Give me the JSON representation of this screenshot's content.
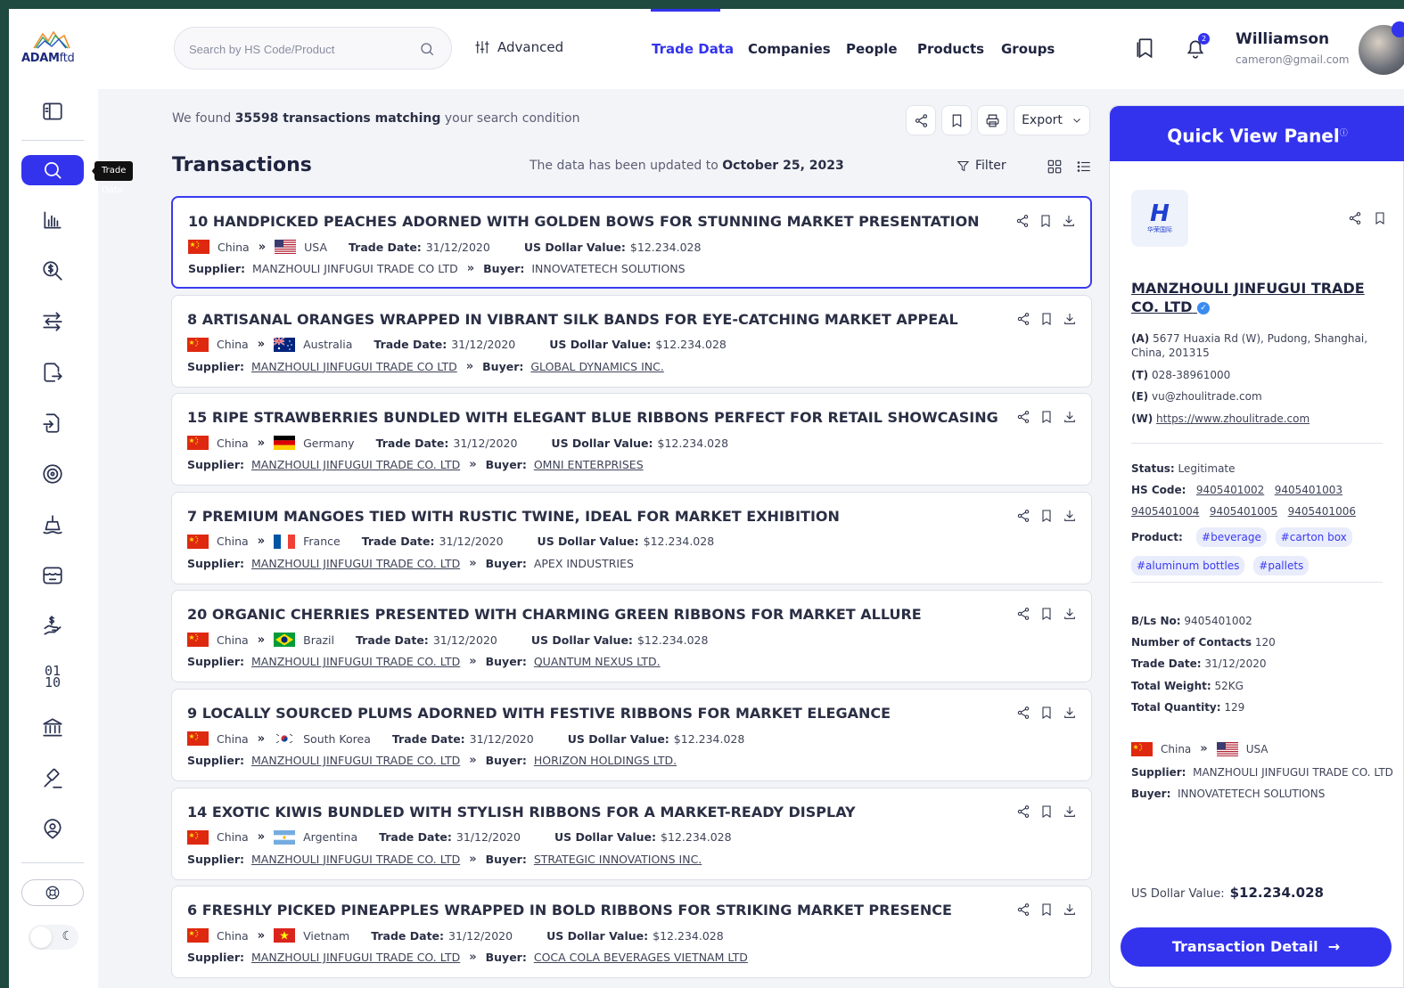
{
  "logo": {
    "brand": "ADAM",
    "suffix": "ftd"
  },
  "sidebar": {
    "tooltip": "Trade Data"
  },
  "search": {
    "placeholder": "Search by HS Code/Product"
  },
  "header": {
    "advanced_label": "Advanced",
    "nav": [
      {
        "label": "Trade Data",
        "active": true
      },
      {
        "label": "Companies",
        "active": false
      },
      {
        "label": "People",
        "active": false
      },
      {
        "label": "Products",
        "active": false
      },
      {
        "label": "Groups",
        "active": false
      }
    ],
    "notification_count": "2",
    "user": {
      "name": "Williamson",
      "email": "cameron@gmail.com"
    }
  },
  "results": {
    "found_prefix": "We found",
    "found_count_text": "35598 transactions matching",
    "found_suffix": "your search condition",
    "export_label": "Export",
    "title": "Transactions",
    "updated_prefix": "The data has been updated to",
    "updated_date": "October 25, 2023",
    "filter_label": "Filter"
  },
  "labels": {
    "trade_date": "Trade Date:",
    "usd_value": "US Dollar Value:",
    "supplier": "Supplier:",
    "buyer": "Buyer:"
  },
  "transactions": [
    {
      "title": "10 HANDPICKED PEACHES ADORNED WITH GOLDEN BOWS FOR STUNNING MARKET PRESENTATION",
      "origin": "China",
      "origin_flag": "cn",
      "destination": "USA",
      "destination_flag": "us",
      "trade_date": "31/12/2020",
      "usd_value": "$12.234.028",
      "supplier": "MANZHOULI JINFUGUI TRADE CO LTD",
      "buyer": "INNOVATETECH SOLUTIONS",
      "selected": true
    },
    {
      "title": "8 ARTISANAL ORANGES WRAPPED IN VIBRANT SILK BANDS FOR EYE-CATCHING MARKET APPEAL",
      "origin": "China",
      "origin_flag": "cn",
      "destination": "Australia",
      "destination_flag": "au",
      "trade_date": "31/12/2020",
      "usd_value": "$12.234.028",
      "supplier": "MANZHOULI JINFUGUI TRADE CO LTD",
      "buyer": "GLOBAL DYNAMICS INC.",
      "selected": false
    },
    {
      "title": "15 RIPE STRAWBERRIES BUNDLED WITH ELEGANT BLUE RIBBONS PERFECT FOR RETAIL SHOWCASING",
      "origin": "China",
      "origin_flag": "cn",
      "destination": "Germany",
      "destination_flag": "de",
      "trade_date": "31/12/2020",
      "usd_value": "$12.234.028",
      "supplier": "MANZHOULI JINFUGUI TRADE CO. LTD",
      "buyer": "OMNI ENTERPRISES",
      "selected": false
    },
    {
      "title": "7 PREMIUM MANGOES TIED WITH RUSTIC TWINE, IDEAL FOR MARKET EXHIBITION",
      "origin": "China",
      "origin_flag": "cn",
      "destination": "France",
      "destination_flag": "fr",
      "trade_date": "31/12/2020",
      "usd_value": "$12.234.028",
      "supplier": "MANZHOULI JINFUGUI TRADE CO. LTD",
      "buyer": "APEX INDUSTRIES",
      "selected": false
    },
    {
      "title": "20 ORGANIC CHERRIES PRESENTED WITH CHARMING GREEN RIBBONS FOR MARKET ALLURE",
      "origin": "China",
      "origin_flag": "cn",
      "destination": "Brazil",
      "destination_flag": "br",
      "trade_date": "31/12/2020",
      "usd_value": "$12.234.028",
      "supplier": "MANZHOULI JINFUGUI TRADE CO. LTD",
      "buyer": "QUANTUM NEXUS LTD.",
      "selected": false
    },
    {
      "title": "9 LOCALLY SOURCED PLUMS ADORNED WITH FESTIVE RIBBONS FOR MARKET ELEGANCE",
      "origin": "China",
      "origin_flag": "cn",
      "destination": "South Korea",
      "destination_flag": "kr",
      "trade_date": "31/12/2020",
      "usd_value": "$12.234.028",
      "supplier": "MANZHOULI JINFUGUI TRADE CO. LTD",
      "buyer": "HORIZON HOLDINGS LTD.",
      "selected": false
    },
    {
      "title": "14 EXOTIC KIWIS BUNDLED WITH STYLISH RIBBONS FOR A MARKET-READY DISPLAY",
      "origin": "China",
      "origin_flag": "cn",
      "destination": "Argentina",
      "destination_flag": "ar",
      "trade_date": "31/12/2020",
      "usd_value": "$12.234.028",
      "supplier": "MANZHOULI JINFUGUI TRADE CO. LTD",
      "buyer": "STRATEGIC INNOVATIONS INC.",
      "selected": false
    },
    {
      "title": "6 FRESHLY PICKED PINEAPPLES WRAPPED IN BOLD RIBBONS FOR STRIKING MARKET PRESENCE",
      "origin": "China",
      "origin_flag": "cn",
      "destination": "Vietnam",
      "destination_flag": "vn",
      "trade_date": "31/12/2020",
      "usd_value": "$12.234.028",
      "supplier": "MANZHOULI JINFUGUI TRADE CO. LTD",
      "buyer": "COCA COLA BEVERAGES VIETNAM LTD",
      "selected": false
    }
  ],
  "quick_view": {
    "title": "Quick View Panel",
    "info_mark": "ⓘ",
    "logo_text": "H",
    "logo_subtext": "华荣国际",
    "company_name": "MANZHOULI JINFUGUI TRADE CO. LTD",
    "address_label": "(A)",
    "address": "5677 Huaxia Rd (W), Pudong, Shanghai, China, 201315",
    "phone_label": "(T)",
    "phone": "028-38961000",
    "email_label": "(E)",
    "email": "vu@zhoulitrade.com",
    "website_label": "(W)",
    "website": "https://www.zhoulitrade.com",
    "status_label": "Status:",
    "status": "Legitimate",
    "hs_label": "HS Code:",
    "hs_codes": [
      "9405401002",
      "9405401003",
      "9405401004",
      "9405401005",
      "9405401006"
    ],
    "product_label": "Product:",
    "products": [
      "#beverage",
      "#carton box",
      "#aluminum bottles",
      "#pallets"
    ],
    "bl_label": "B/Ls No:",
    "bl_no": "9405401002",
    "contacts_label": "Number of Contacts",
    "contacts": "120",
    "trade_date_label": "Trade Date:",
    "trade_date": "31/12/2020",
    "weight_label": "Total Weight:",
    "weight": "52KG",
    "quantity_label": "Total Quantity:",
    "quantity": "129",
    "origin": "China",
    "destination": "USA",
    "supplier_label": "Supplier:",
    "supplier": "MANZHOULI JINFUGUI TRADE CO. LTD",
    "buyer_label": "Buyer:",
    "buyer": "INNOVATETECH SOLUTIONS",
    "usd_label": "US Dollar Value:",
    "usd_value": "$12.234.028",
    "detail_button": "Transaction Detail"
  },
  "colors": {
    "accent": "#3333ee",
    "frame": "#1e4a3f",
    "background": "#f3f4f8"
  }
}
